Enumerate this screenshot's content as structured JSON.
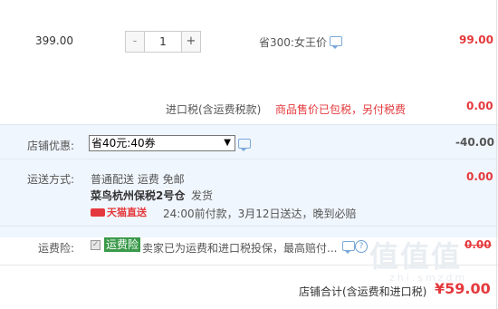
{
  "item": {
    "unit_price": "399.00",
    "quantity": "1",
    "minus": "-",
    "plus": "+",
    "promo": "省300:女王价",
    "subtotal": "99.00"
  },
  "tax": {
    "label": "进口税(含运费税款)",
    "note": "商品售价已包税，另付税费",
    "amount": "0.00"
  },
  "coupon": {
    "label": "店铺优惠:",
    "selected": "省40元:40券",
    "arrow": "▼",
    "amount": "-40.00"
  },
  "shipping": {
    "label": "运送方式:",
    "method": "普通配送  运费 免邮",
    "warehouse": "菜鸟杭州保税2号仓",
    "ship_word": "发货",
    "badge": "天猫直送",
    "eta": "24:00前付款，3月12日送达，晚到必赔",
    "amount": "0.00"
  },
  "insurance": {
    "label": "运费险:",
    "tag": "运费险",
    "text": "卖家已为运费和进口税投保，最高赔付...",
    "amount": "0.00",
    "help": "?"
  },
  "total": {
    "label": "店铺合计(含运费和进口税)",
    "amount": "¥59.00"
  },
  "watermark": {
    "text": "值值值",
    "sub": "zhi.smzdm"
  },
  "colors": {
    "accent_red": "#e4393c",
    "band_blue": "#f0f6fd",
    "tag_green": "#3a9a4a"
  }
}
